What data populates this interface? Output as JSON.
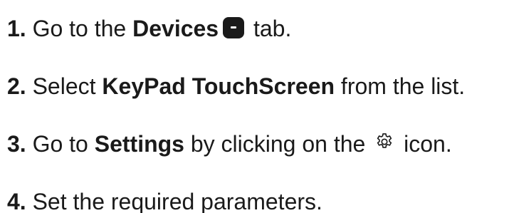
{
  "steps": [
    {
      "num": "1.",
      "t1": " Go to the ",
      "b1": "Devices",
      "t2": " tab."
    },
    {
      "num": "2.",
      "t1": " Select ",
      "b1": "KeyPad TouchScreen",
      "t2": " from the list."
    },
    {
      "num": "3.",
      "t1": " Go to ",
      "b1": "Settings",
      "t2": " by clicking on the ",
      "t3": " icon."
    },
    {
      "num": "4.",
      "t1": " Set the required parameters."
    }
  ],
  "icons": {
    "devices": "devices-tab-icon",
    "settings": "gear-icon"
  },
  "colors": {
    "text": "#1a1a1a",
    "background": "#ffffff"
  }
}
